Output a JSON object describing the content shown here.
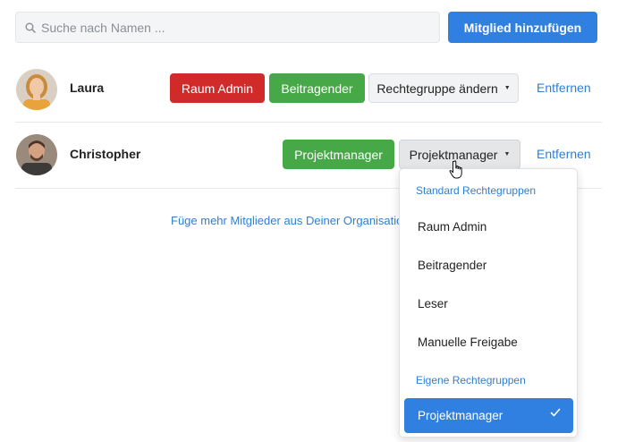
{
  "search": {
    "placeholder": "Suche nach Namen ...",
    "value": ""
  },
  "add_member_button": "Mitglied hinzufügen",
  "members": [
    {
      "name": "Laura",
      "roles": [
        "Raum Admin",
        "Beitragender"
      ],
      "role_dropdown_label": "Rechtegruppe ändern",
      "remove_label": "Entfernen"
    },
    {
      "name": "Christopher",
      "roles": [
        "Projektmanager"
      ],
      "role_dropdown_label": "Projektmanager",
      "remove_label": "Entfernen"
    }
  ],
  "footer_link": "Füge mehr Mitglieder aus Deiner Organisation hinzu",
  "dropdown": {
    "standard_header": "Standard Rechtegruppen",
    "standard_items": [
      "Raum Admin",
      "Beitragender",
      "Leser",
      "Manuelle Freigabe"
    ],
    "custom_header": "Eigene Rechtegruppen",
    "custom_items": [
      "Projektmanager"
    ],
    "selected": "Projektmanager"
  },
  "colors": {
    "primary": "#2f80e0",
    "danger": "#d02a2a",
    "success": "#46a846",
    "link": "#2f7fd0"
  }
}
